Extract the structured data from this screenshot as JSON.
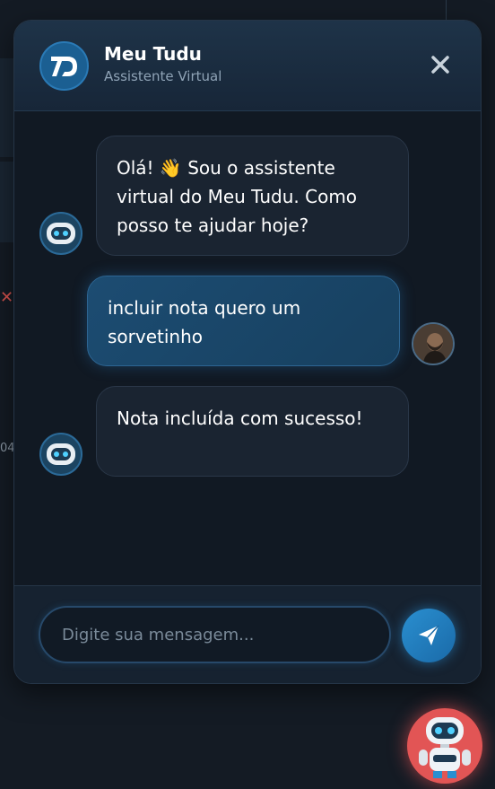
{
  "header": {
    "title": "Meu Tudu",
    "subtitle": "Assistente Virtual"
  },
  "messages": [
    {
      "sender": "bot",
      "text": "Olá! 👋 Sou o assistente virtual do Meu Tudu. Como posso te ajudar hoje?"
    },
    {
      "sender": "user",
      "text": "incluir nota quero um sorvetinho"
    },
    {
      "sender": "bot",
      "text": "Nota incluída com sucesso!"
    }
  ],
  "input": {
    "placeholder": "Digite sua mensagem...",
    "value": ""
  },
  "background": {
    "fragment_number": "04"
  },
  "icons": {
    "logo": "meu-tudu-logo",
    "close": "close-icon",
    "bot_avatar": "robot-icon",
    "send": "paper-plane-icon",
    "fab": "robot-mascot-icon"
  },
  "colors": {
    "accent": "#2a8fd0",
    "user_bubble": "#1c4c72",
    "bot_bubble": "#1a2431",
    "fab": "#e25555"
  }
}
